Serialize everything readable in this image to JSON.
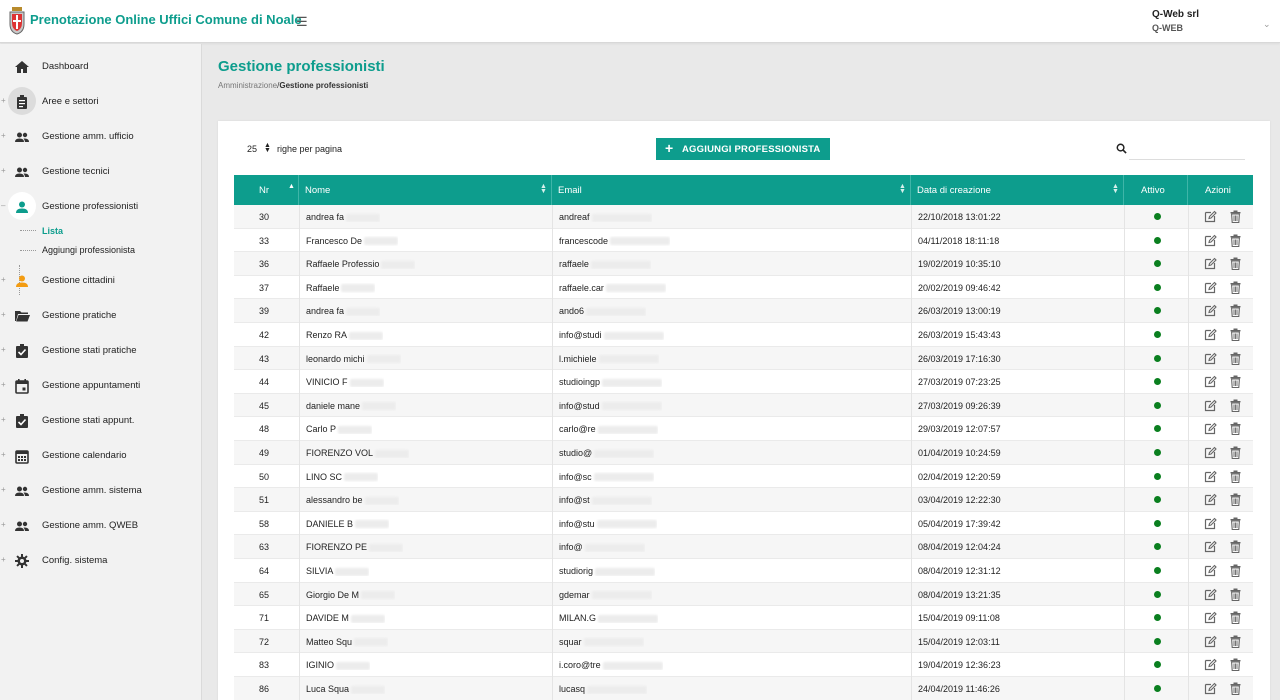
{
  "header": {
    "title": "Prenotazione Online Uffici Comune di Noale",
    "user_name": "Q-Web srl",
    "user_org": "Q-WEB"
  },
  "sidebar": {
    "items": [
      {
        "label": "Dashboard",
        "icon": "home-icon"
      },
      {
        "label": "Aree e settori",
        "icon": "clipboard-icon"
      },
      {
        "label": "Gestione amm. ufficio",
        "icon": "people-icon"
      },
      {
        "label": "Gestione tecnici",
        "icon": "people-icon"
      },
      {
        "label": "Gestione professionisti",
        "icon": "person-icon"
      },
      {
        "label": "Gestione cittadini",
        "icon": "person-icon"
      },
      {
        "label": "Gestione pratiche",
        "icon": "folder-open-icon"
      },
      {
        "label": "Gestione stati pratiche",
        "icon": "assignment-check-icon"
      },
      {
        "label": "Gestione appuntamenti",
        "icon": "calendar-event-icon"
      },
      {
        "label": "Gestione stati appunt.",
        "icon": "assignment-check-icon"
      },
      {
        "label": "Gestione calendario",
        "icon": "calendar-grid-icon"
      },
      {
        "label": "Gestione amm. sistema",
        "icon": "people-icon"
      },
      {
        "label": "Gestione amm. QWEB",
        "icon": "people-icon"
      },
      {
        "label": "Config. sistema",
        "icon": "gear-icon"
      }
    ],
    "sub_items": [
      "Lista",
      "Aggiungi professionista"
    ],
    "colors": {
      "accent": "#0d9d8d",
      "citizen_icon": "#f39c12"
    }
  },
  "page": {
    "title": "Gestione professionisti",
    "breadcrumb_root": "Amministrazione",
    "breadcrumb_sep": "/",
    "breadcrumb_current": "Gestione professionisti"
  },
  "toolbar": {
    "per_page_value": "25",
    "per_page_label": "righe per pagina",
    "add_button_label": "AGGIUNGI PROFESSIONISTA",
    "search_placeholder": ""
  },
  "table": {
    "columns": [
      "Nr",
      "Nome",
      "Email",
      "Data di creazione",
      "Attivo",
      "Azioni"
    ],
    "rows": [
      {
        "nr": "30",
        "nome": "andrea fa",
        "email": "andreaf",
        "data": "22/10/2018 13:01:22"
      },
      {
        "nr": "33",
        "nome": "Francesco De",
        "email": "francescode",
        "data": "04/11/2018 18:11:18"
      },
      {
        "nr": "36",
        "nome": "Raffaele Professio",
        "email": "raffaele",
        "data": "19/02/2019 10:35:10"
      },
      {
        "nr": "37",
        "nome": "Raffaele",
        "email": "raffaele.car",
        "data": "20/02/2019 09:46:42"
      },
      {
        "nr": "39",
        "nome": "andrea fa",
        "email": "ando6",
        "data": "26/03/2019 13:00:19"
      },
      {
        "nr": "42",
        "nome": "Renzo RA",
        "email": "info@studi",
        "data": "26/03/2019 15:43:43"
      },
      {
        "nr": "43",
        "nome": "leonardo michi",
        "email": "l.michiele",
        "data": "26/03/2019 17:16:30"
      },
      {
        "nr": "44",
        "nome": "VINICIO F",
        "email": "studioingp",
        "data": "27/03/2019 07:23:25"
      },
      {
        "nr": "45",
        "nome": "daniele mane",
        "email": "info@stud",
        "data": "27/03/2019 09:26:39"
      },
      {
        "nr": "48",
        "nome": "Carlo P",
        "email": "carlo@re",
        "data": "29/03/2019 12:07:57"
      },
      {
        "nr": "49",
        "nome": "FIORENZO VOL",
        "email": "studio@",
        "data": "01/04/2019 10:24:59"
      },
      {
        "nr": "50",
        "nome": "LINO SC",
        "email": "info@sc",
        "data": "02/04/2019 12:20:59"
      },
      {
        "nr": "51",
        "nome": "alessandro be",
        "email": "info@st",
        "data": "03/04/2019 12:22:30"
      },
      {
        "nr": "58",
        "nome": "DANIELE B",
        "email": "info@stu",
        "data": "05/04/2019 17:39:42"
      },
      {
        "nr": "63",
        "nome": "FIORENZO PE",
        "email": "info@",
        "data": "08/04/2019 12:04:24"
      },
      {
        "nr": "64",
        "nome": "SILVIA",
        "email": "studiorig",
        "data": "08/04/2019 12:31:12"
      },
      {
        "nr": "65",
        "nome": "Giorgio De M",
        "email": "gdemar",
        "data": "08/04/2019 13:21:35"
      },
      {
        "nr": "71",
        "nome": "DAVIDE M",
        "email": "MILAN.G",
        "data": "15/04/2019 09:11:08"
      },
      {
        "nr": "72",
        "nome": "Matteo Squ",
        "email": "squar",
        "data": "15/04/2019 12:03:11"
      },
      {
        "nr": "83",
        "nome": "IGINIO",
        "email": "i.coro@tre",
        "data": "19/04/2019 12:36:23"
      },
      {
        "nr": "86",
        "nome": "Luca Squa",
        "email": "lucasq",
        "data": "24/04/2019 11:46:26"
      }
    ],
    "active_color": "#0a7f1f"
  }
}
